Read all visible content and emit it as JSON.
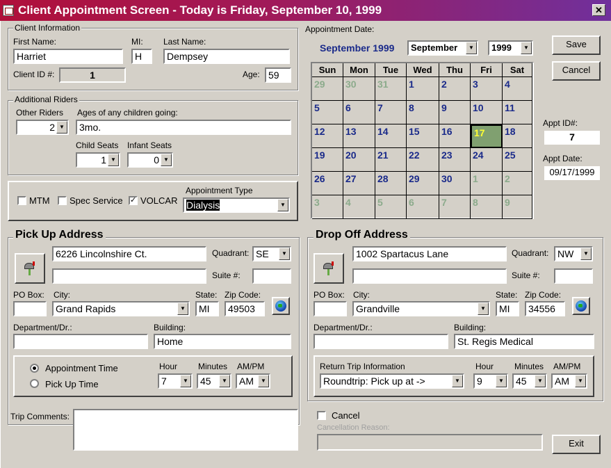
{
  "window": {
    "title": "Client Appointment Screen - Today is Friday, September 10, 1999"
  },
  "client": {
    "group_label": "Client Information",
    "first_name_label": "First Name:",
    "first_name": "Harriet",
    "mi_label": "MI:",
    "mi": "H",
    "last_name_label": "Last Name:",
    "last_name": "Dempsey",
    "client_id_label": "Client ID #:",
    "client_id": "1",
    "age_label": "Age:",
    "age": "59"
  },
  "riders": {
    "group_label": "Additional Riders",
    "other_riders_label": "Other Riders",
    "other_riders": "2",
    "ages_label": "Ages of any children going:",
    "ages": "3mo.",
    "child_seats_label": "Child Seats",
    "child_seats": "1",
    "infant_seats_label": "Infant Seats",
    "infant_seats": "0"
  },
  "service": {
    "mtm_label": "MTM",
    "mtm": false,
    "spec_label": "Spec Service",
    "spec": false,
    "volcar_label": "VOLCAR",
    "volcar": true,
    "appt_type_label": "Appointment Type",
    "appt_type": "Dialysis"
  },
  "calendar": {
    "label": "Appointment Date:",
    "header": "September 1999",
    "month": "September",
    "year": "1999",
    "weekdays": [
      "Sun",
      "Mon",
      "Tue",
      "Wed",
      "Thu",
      "Fri",
      "Sat"
    ],
    "weeks": [
      [
        "29",
        "30",
        "31",
        "1",
        "2",
        "3",
        "4"
      ],
      [
        "5",
        "6",
        "7",
        "8",
        "9",
        "10",
        "11"
      ],
      [
        "12",
        "13",
        "14",
        "15",
        "16",
        "17",
        "18"
      ],
      [
        "19",
        "20",
        "21",
        "22",
        "23",
        "24",
        "25"
      ],
      [
        "26",
        "27",
        "28",
        "29",
        "30",
        "1",
        "2"
      ],
      [
        "3",
        "4",
        "5",
        "6",
        "7",
        "8",
        "9"
      ]
    ],
    "selected": "17"
  },
  "buttons": {
    "save": "Save",
    "cancel": "Cancel",
    "exit": "Exit"
  },
  "appt": {
    "id_label": "Appt ID#:",
    "id": "7",
    "date_label": "Appt Date:",
    "date": "09/17/1999"
  },
  "pickup": {
    "title": "Pick Up Address",
    "address1": "6226 Lincolnshire Ct.",
    "address2": "",
    "quadrant_label": "Quadrant:",
    "quadrant": "SE",
    "suite_label": "Suite #:",
    "suite": "",
    "pobox_label": "PO Box:",
    "pobox": "",
    "city_label": "City:",
    "city": "Grand Rapids",
    "state_label": "State:",
    "state": "MI",
    "zip_label": "Zip Code:",
    "zip": "49503",
    "dept_label": "Department/Dr.:",
    "dept": "",
    "building_label": "Building:",
    "building": "Home",
    "appt_time_label": "Appointment Time",
    "pickup_time_label": "Pick Up Time",
    "hour_label": "Hour",
    "hour": "7",
    "minutes_label": "Minutes",
    "minutes": "45",
    "ampm_label": "AM/PM",
    "ampm": "AM"
  },
  "dropoff": {
    "title": "Drop Off Address",
    "address1": "1002 Spartacus Lane",
    "address2": "",
    "quadrant_label": "Quadrant:",
    "quadrant": "NW",
    "suite_label": "Suite #:",
    "suite": "",
    "pobox_label": "PO Box:",
    "pobox": "",
    "city_label": "City:",
    "city": "Grandville",
    "state_label": "State:",
    "state": "MI",
    "zip_label": "Zip Code:",
    "zip": "34556",
    "dept_label": "Department/Dr.:",
    "dept": "",
    "building_label": "Building:",
    "building": "St. Regis Medical",
    "return_label": "Return Trip Information",
    "return_value": "Roundtrip: Pick up at ->",
    "hour_label": "Hour",
    "hour": "9",
    "minutes_label": "Minutes",
    "minutes": "45",
    "ampm_label": "AM/PM",
    "ampm": "AM"
  },
  "comments": {
    "label": "Trip Comments:",
    "value": ""
  },
  "cancellation": {
    "cancel_label": "Cancel",
    "reason_label": "Cancellation Reason:",
    "reason": ""
  }
}
